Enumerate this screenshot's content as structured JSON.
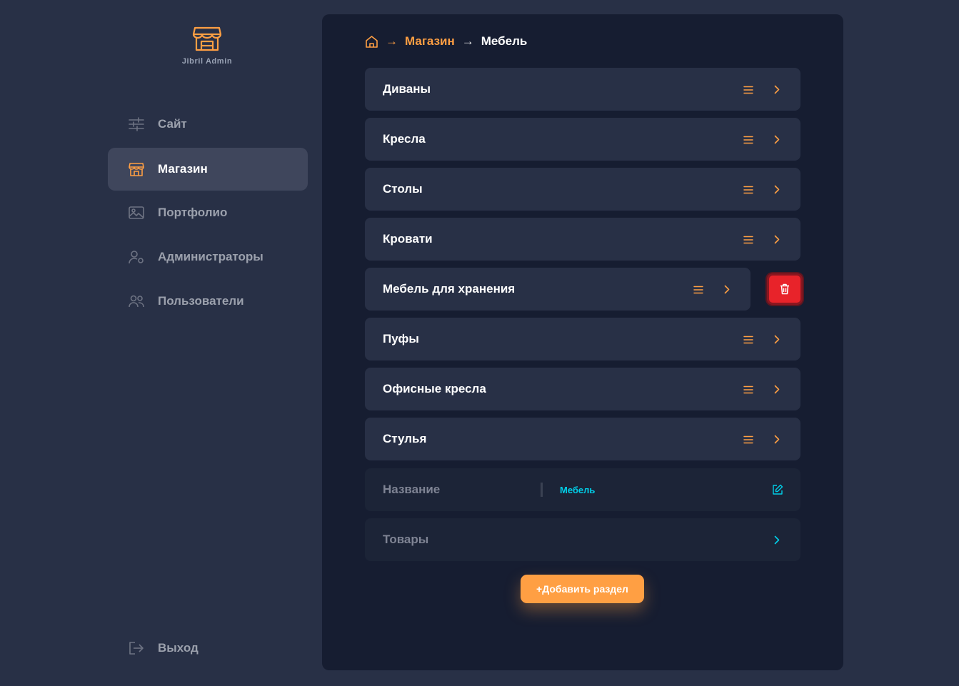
{
  "brand": {
    "name": "Jibril Admin",
    "logo_icon": "store-icon",
    "accent": "#ff9f43"
  },
  "sidebar": {
    "items": [
      {
        "label": "Сайт",
        "icon": "sliders-icon",
        "active": false
      },
      {
        "label": "Магазин",
        "icon": "store-icon",
        "active": true
      },
      {
        "label": "Портфолио",
        "icon": "image-icon",
        "active": false
      },
      {
        "label": "Администраторы",
        "icon": "user-gear-icon",
        "active": false
      },
      {
        "label": "Пользователи",
        "icon": "users-icon",
        "active": false
      }
    ],
    "logout_label": "Выход"
  },
  "breadcrumb": {
    "home_icon": "home-icon",
    "separator": "→",
    "parent": "Магазин",
    "current": "Мебель"
  },
  "categories": [
    "Диваны",
    "Кресла",
    "Столы",
    "Кровати",
    "Мебель для хранения",
    "Пуфы",
    "Офисные кресла",
    "Стулья"
  ],
  "details": {
    "name_label": "Название",
    "name_value": "Мебель",
    "products_label": "Товары"
  },
  "actions": {
    "add_section_label": "+Добавить раздел",
    "delete_color": "#e8232a"
  }
}
